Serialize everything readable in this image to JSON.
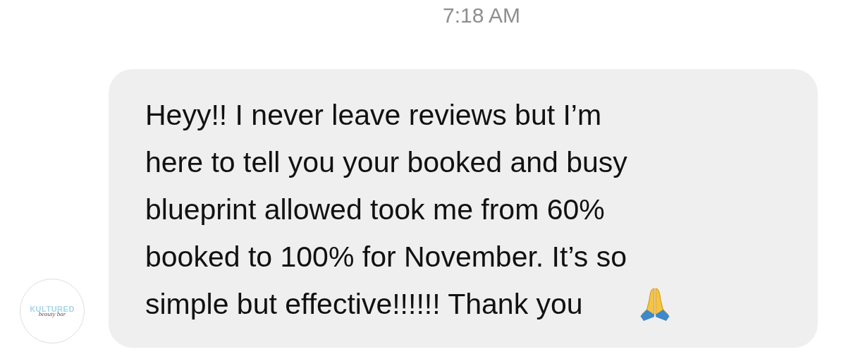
{
  "timestamp": "7:18 AM",
  "avatar": {
    "logo_text": "KULTURED",
    "logo_subtext": "beauty bar"
  },
  "message": {
    "lines": [
      "Heyy!! I never leave reviews but I’m",
      "here to tell you your booked and busy",
      "blueprint allowed took me from 60%",
      "booked to 100% for November. It’s so",
      "simple but effective!!!!!! Thank you"
    ]
  }
}
